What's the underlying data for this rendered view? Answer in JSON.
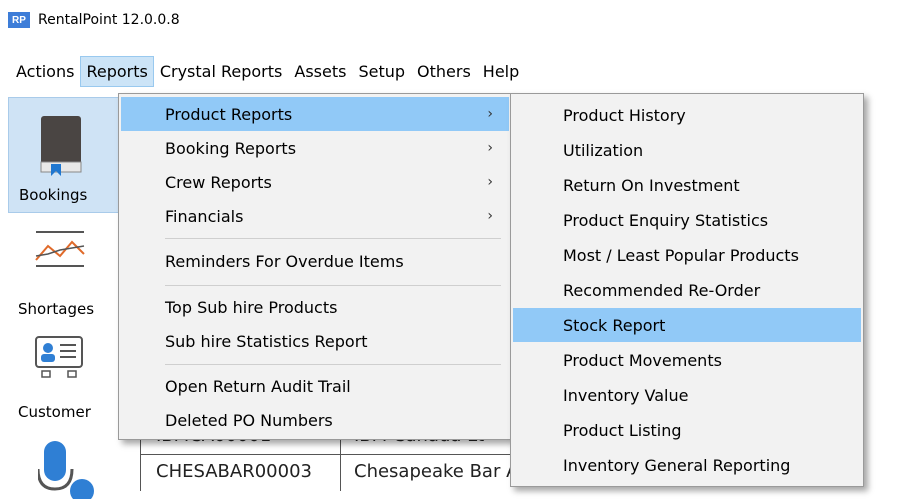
{
  "window": {
    "app_icon_text": "RP",
    "title": "RentalPoint 12.0.0.8"
  },
  "menubar": {
    "items": [
      {
        "label": "Actions"
      },
      {
        "label": "Reports"
      },
      {
        "label": "Crystal Reports"
      },
      {
        "label": "Assets"
      },
      {
        "label": "Setup"
      },
      {
        "label": "Others"
      },
      {
        "label": "Help"
      }
    ]
  },
  "sidebar": {
    "items": [
      {
        "label": "Bookings",
        "icon": "book-icon"
      },
      {
        "label": "Shortages",
        "icon": "chart-icon"
      },
      {
        "label": "Customer",
        "icon": "contact-card-icon"
      },
      {
        "label": "",
        "icon": "microphone-icon"
      }
    ]
  },
  "grid": {
    "rows": [
      {
        "code": "IBMCA00001",
        "name": "IBM Canada Lt"
      },
      {
        "code": "CHESABAR00003",
        "name": "Chesapeake Bar Association Inc"
      }
    ]
  },
  "reports_menu": {
    "items": [
      {
        "label": "Product Reports",
        "submenu": true
      },
      {
        "label": "Booking Reports",
        "submenu": true
      },
      {
        "label": "Crew Reports",
        "submenu": true
      },
      {
        "label": "Financials",
        "submenu": true
      },
      {
        "label": "Reminders For Overdue Items"
      },
      {
        "label": "Top Sub hire Products"
      },
      {
        "label": "Sub hire Statistics Report"
      },
      {
        "label": "Open Return Audit Trail"
      },
      {
        "label": "Deleted PO Numbers"
      }
    ]
  },
  "product_reports_submenu": {
    "items": [
      {
        "label": "Product History"
      },
      {
        "label": "Utilization"
      },
      {
        "label": "Return On Investment"
      },
      {
        "label": "Product Enquiry Statistics"
      },
      {
        "label": "Most / Least Popular Products"
      },
      {
        "label": "Recommended Re-Order"
      },
      {
        "label": "Stock Report"
      },
      {
        "label": "Product Movements"
      },
      {
        "label": "Inventory Value"
      },
      {
        "label": "Product Listing"
      },
      {
        "label": "Inventory General Reporting"
      }
    ]
  },
  "colors": {
    "highlight": "#91c9f7",
    "menu_bg": "#f2f2f2",
    "active_menu": "#cce4f7"
  }
}
